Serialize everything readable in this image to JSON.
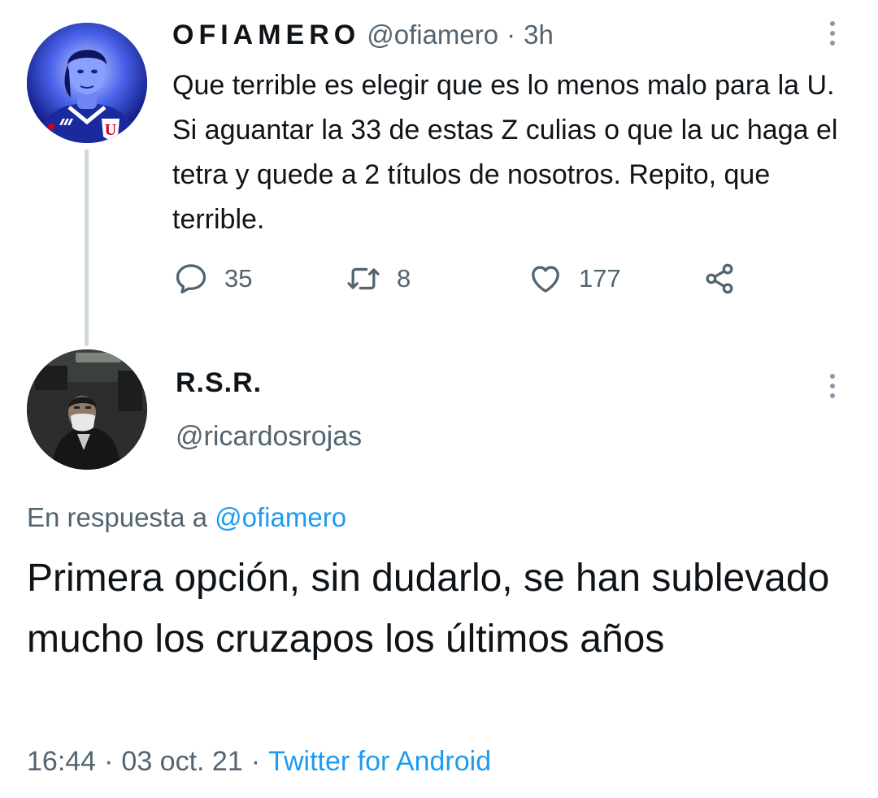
{
  "parent_tweet": {
    "display_name": "OFIAMERO",
    "handle": "@ofiamero",
    "separator": "·",
    "time": "3h",
    "text": "Que terrible es elegir que es lo menos malo para la U. Si aguantar la 33 de estas Z culias o que la uc haga el tetra y quede a 2 títulos de nosotros. Repito, que terrible.",
    "reply_count": "35",
    "retweet_count": "8",
    "like_count": "177",
    "avatar_icon": "profile-photo-blue-jersey"
  },
  "reply_tweet": {
    "display_name": "R.S.R.",
    "handle": "@ricardosrojas",
    "reply_label": "En respuesta a",
    "reply_mention": "@ofiamero",
    "text": "Primera opción, sin dudarlo, se han sublevado mucho los cruzapos los últimos años",
    "time": "16:44",
    "date": "03 oct. 21",
    "separator": "·",
    "source": "Twitter for Android",
    "avatar_icon": "profile-photo-masked-man"
  },
  "colors": {
    "text_primary": "#0f1419",
    "text_secondary": "#536471",
    "link": "#1d9bf0",
    "thread_line": "#cfd9de"
  }
}
